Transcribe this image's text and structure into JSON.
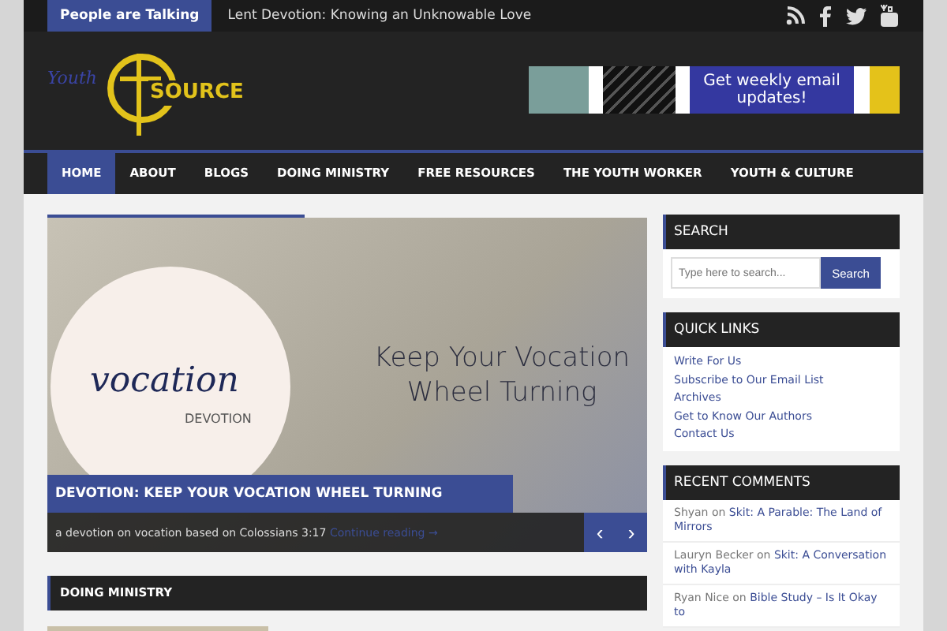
{
  "top_bar": {
    "label": "People are Talking",
    "headline": "Lent Devotion: Knowing an Unknowable Love",
    "social": [
      {
        "kind": "rss"
      },
      {
        "kind": "facebook"
      },
      {
        "kind": "twitter"
      },
      {
        "kind": "youtube"
      }
    ]
  },
  "header": {
    "logo": {
      "script": "Youth",
      "word": "SOURCE"
    },
    "banner": {
      "text": "Get weekly email updates!"
    }
  },
  "nav": [
    {
      "label": "HOME",
      "selected": true
    },
    {
      "label": "ABOUT",
      "selected": false
    },
    {
      "label": "BLOGS",
      "selected": false
    },
    {
      "label": "DOING MINISTRY",
      "selected": false
    },
    {
      "label": "FREE RESOURCES",
      "selected": false
    },
    {
      "label": "THE YOUTH WORKER",
      "selected": false
    },
    {
      "label": "YOUTH & CULTURE",
      "selected": false
    }
  ],
  "slider": {
    "image": {
      "circle_word": "vocation",
      "circle_sub": "DEVOTION",
      "headline": "Keep Your Vocation Wheel Turning"
    },
    "title": "DEVOTION: KEEP YOUR VOCATION WHEEL TURNING",
    "excerpt": "a devotion on vocation based on Colossians 3:17",
    "more": "Continue reading →",
    "prev": "‹",
    "next": "›"
  },
  "section": {
    "title": "DOING MINISTRY"
  },
  "sidebar": {
    "search": {
      "title": "SEARCH",
      "placeholder": "Type here to search...",
      "button": "Search"
    },
    "quick_links": {
      "title": "QUICK LINKS",
      "links": [
        "Write For Us",
        "Subscribe to Our Email List",
        "Archives",
        "Get to Know Our Authors",
        "Contact Us"
      ]
    },
    "recent_comments": {
      "title": "RECENT COMMENTS",
      "items": [
        {
          "author": "Shyan",
          "joiner": "on",
          "post": "Skit: A Parable: The Land of Mirrors"
        },
        {
          "author": "Lauryn Becker",
          "joiner": "on",
          "post": "Skit: A Conversation with Kayla"
        },
        {
          "author": "Ryan Nice",
          "joiner": "on",
          "post": "Bible Study – Is It Okay to"
        }
      ]
    }
  }
}
